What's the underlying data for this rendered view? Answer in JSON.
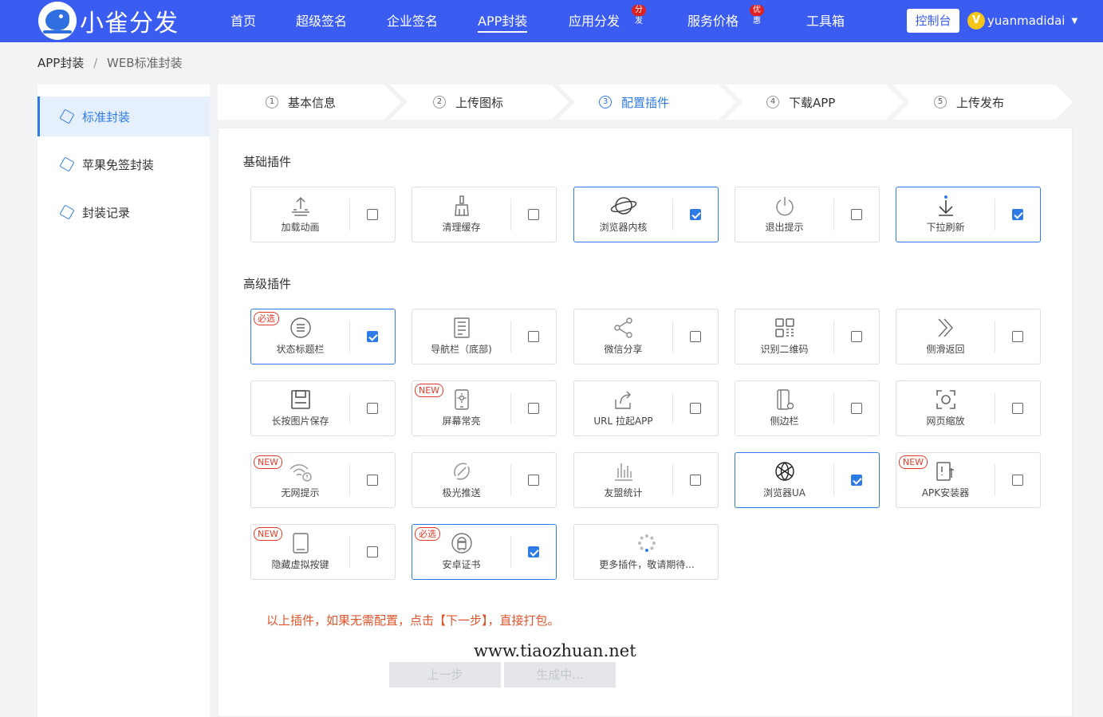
{
  "brand": {
    "name": "小雀分发",
    "icon": "bird-logo"
  },
  "nav": {
    "items": [
      {
        "label": "首页"
      },
      {
        "label": "超级签名"
      },
      {
        "label": "企业签名"
      },
      {
        "label": "APP封装",
        "active": true
      },
      {
        "label": "应用分发",
        "badge": "分发"
      },
      {
        "label": "服务价格",
        "badge": "优惠"
      },
      {
        "label": "工具箱"
      }
    ],
    "console": "控制台",
    "user": {
      "avatar": "V",
      "name": "yuanmadidai"
    }
  },
  "breadcrumb": {
    "root": "APP封装",
    "sep": "/",
    "current": "WEB标准封装"
  },
  "sidebar": {
    "items": [
      {
        "label": "标准封装",
        "active": true
      },
      {
        "label": "苹果免签封装"
      },
      {
        "label": "封装记录"
      }
    ]
  },
  "steps": [
    {
      "num": "1",
      "label": "基本信息"
    },
    {
      "num": "2",
      "label": "上传图标"
    },
    {
      "num": "3",
      "label": "配置插件",
      "active": true
    },
    {
      "num": "4",
      "label": "下载APP"
    },
    {
      "num": "5",
      "label": "上传发布"
    }
  ],
  "sections": {
    "basic": "基础插件",
    "advanced": "高级插件"
  },
  "basic_plugins": [
    {
      "label": "加载动画",
      "icon": "upload-icon",
      "checked": false
    },
    {
      "label": "清理缓存",
      "icon": "broom-icon",
      "checked": false
    },
    {
      "label": "浏览器内核",
      "icon": "planet-icon",
      "checked": true
    },
    {
      "label": "退出提示",
      "icon": "power-icon",
      "checked": false
    },
    {
      "label": "下拉刷新",
      "icon": "pull-down-icon",
      "checked": true
    }
  ],
  "advanced_plugins": [
    {
      "label": "状态标题栏",
      "icon": "list-circle-icon",
      "checked": true,
      "tag": "必选"
    },
    {
      "label": "导航栏（底部)",
      "icon": "document-icon",
      "checked": false
    },
    {
      "label": "微信分享",
      "icon": "share-icon",
      "checked": false
    },
    {
      "label": "识别二维码",
      "icon": "qrcode-icon",
      "checked": false
    },
    {
      "label": "侧滑返回",
      "icon": "double-chevron-icon",
      "checked": false
    },
    {
      "label": "长按图片保存",
      "icon": "save-icon",
      "checked": false
    },
    {
      "label": "屏幕常亮",
      "icon": "phone-bright-icon",
      "checked": false,
      "tag": "NEW"
    },
    {
      "label": "URL 拉起APP",
      "icon": "launch-icon",
      "checked": false
    },
    {
      "label": "侧边栏",
      "icon": "sidebar-phone-icon",
      "checked": false
    },
    {
      "label": "网页缩放",
      "icon": "zoom-icon",
      "checked": false
    },
    {
      "label": "无网提示",
      "icon": "wifi-alert-icon",
      "checked": false,
      "tag": "NEW"
    },
    {
      "label": "极光推送",
      "icon": "push-icon",
      "checked": false
    },
    {
      "label": "友盟统计",
      "icon": "bar-stats-icon",
      "checked": false
    },
    {
      "label": "浏览器UA",
      "icon": "globe-icon",
      "checked": true
    },
    {
      "label": "APK安装器",
      "icon": "installer-icon",
      "checked": false,
      "tag": "NEW"
    },
    {
      "label": "隐藏虚拟按键",
      "icon": "tablet-icon",
      "checked": false,
      "tag": "NEW"
    },
    {
      "label": "安卓证书",
      "icon": "android-icon",
      "checked": true,
      "tag": "必选"
    },
    {
      "label": "更多插件，敬请期待...",
      "icon": "loading-icon",
      "more": true
    }
  ],
  "note": "以上插件，如果无需配置，点击【下一步】，直接打包。",
  "watermark": "www.tiaozhuan.net",
  "buttons": {
    "prev": "上一步",
    "next": "生成中..."
  }
}
